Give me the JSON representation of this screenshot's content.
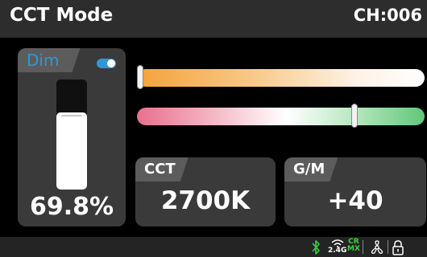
{
  "header": {
    "title": "CCT Mode",
    "channel": "CH:006"
  },
  "dim": {
    "label": "Dim",
    "toggle_on": true,
    "level_fraction": 0.698,
    "value": "69.8%"
  },
  "sliders": {
    "cct_position": 0.01,
    "gm_position": 0.755
  },
  "cct": {
    "label": "CCT",
    "value": "2700K"
  },
  "gm": {
    "label": "G/M",
    "value": "+40"
  },
  "status": {
    "wifi_label": "2.4G",
    "crmx_top": "CR",
    "crmx_bottom": "MX",
    "icons": [
      "bluetooth-icon",
      "wifi-24g-icon",
      "crmx-icon",
      "fan-icon",
      "lock-icon"
    ]
  },
  "colors": {
    "accent": "#2f97d6",
    "crmx": "#3ecf3e",
    "bluetooth": "#3ecf3e"
  }
}
